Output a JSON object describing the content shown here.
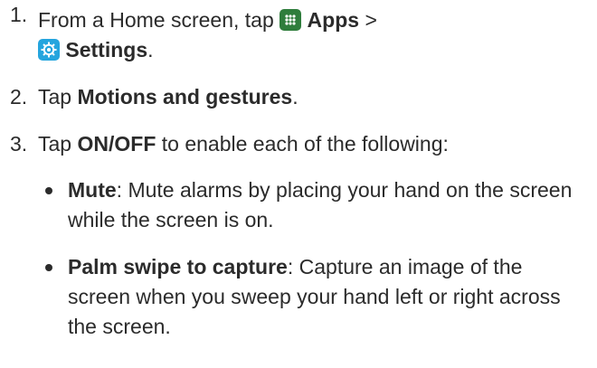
{
  "steps": [
    {
      "number": "1.",
      "text_a": "From a Home screen, tap",
      "icon1": "apps-grid-icon",
      "bold1": "Apps",
      "sep": ">",
      "icon2": "settings-gear-icon",
      "bold2": "Settings",
      "end": "."
    },
    {
      "number": "2.",
      "text_a": "Tap",
      "bold1": "Motions and gestures",
      "end": "."
    },
    {
      "number": "3.",
      "text_a": "Tap",
      "bold1": "ON/OFF",
      "text_b": "to enable each of the following:"
    }
  ],
  "bullets": [
    {
      "title": "Mute",
      "desc": ": Mute alarms by placing your hand on the screen while the screen is on."
    },
    {
      "title": "Palm swipe to capture",
      "desc": ": Capture an image of the screen when you sweep your hand left or right across the screen."
    }
  ],
  "colors": {
    "apps_icon_bg": "#2f7d3c",
    "settings_icon_bg": "#25a5de",
    "text": "#2b2b2b"
  }
}
